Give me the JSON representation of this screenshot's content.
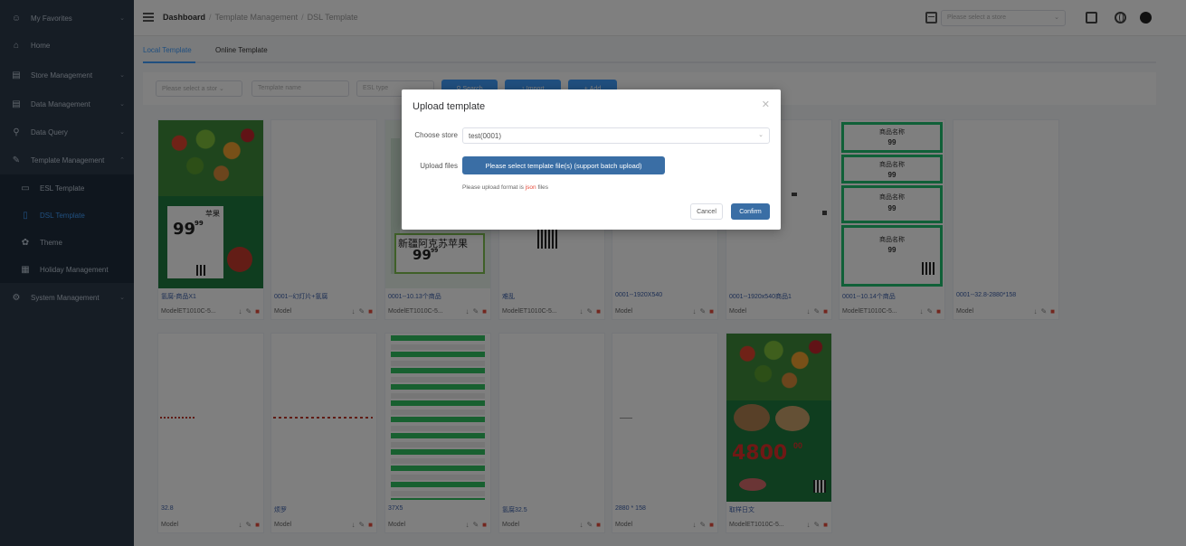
{
  "sidebar": {
    "items": [
      {
        "label": "My Favorites",
        "icon": "user-icon"
      },
      {
        "label": "Home",
        "icon": "home-icon"
      },
      {
        "label": "Store Management",
        "icon": "store-icon"
      },
      {
        "label": "Data Management",
        "icon": "database-icon"
      },
      {
        "label": "Data Query",
        "icon": "search-icon"
      },
      {
        "label": "Template Management",
        "icon": "template-icon"
      },
      {
        "label": "ESL Template",
        "icon": "monitor-icon"
      },
      {
        "label": "DSL Template",
        "icon": "tablet-icon"
      },
      {
        "label": "Theme",
        "icon": "palette-icon"
      },
      {
        "label": "Holiday Management",
        "icon": "calendar-icon"
      },
      {
        "label": "System Management",
        "icon": "gear-icon"
      }
    ]
  },
  "header": {
    "breadcrumb": [
      "Dashboard",
      "Template Management",
      "DSL Template"
    ],
    "store_placeholder": "Please select a store"
  },
  "tabs": [
    "Local Template",
    "Online Template"
  ],
  "filters": {
    "store_placeholder": "Please select a stor",
    "name_placeholder": "Template name",
    "type_placeholder": "ESL type",
    "search": "Search",
    "import": "Import",
    "add": "Add"
  },
  "cards": [
    {
      "title": "氢腐-商品X1",
      "model": "ModelET1010C-5..."
    },
    {
      "title": "0001--幻灯片+氢腐",
      "model": "Model"
    },
    {
      "title": "0001--10.13个商品",
      "model": "ModelET1010C-5..."
    },
    {
      "title": "难乱",
      "model": "ModelET1010C-5..."
    },
    {
      "title": "0001--1920X540",
      "model": "Model"
    },
    {
      "title": "0001--1920x540商品1",
      "model": "Model"
    },
    {
      "title": "0001--10.14个商品",
      "model": "ModelET1010C-5..."
    },
    {
      "title": "0001--32.8-2880*158",
      "model": "Model"
    },
    {
      "title": "32.8",
      "model": "Model"
    },
    {
      "title": "烦罗",
      "model": "Model"
    },
    {
      "title": "37X5",
      "model": "Model"
    },
    {
      "title": "氢腐32.5",
      "model": "Model"
    },
    {
      "title": "2880 * 158",
      "model": "Model"
    },
    {
      "title": "取样日文",
      "model": "ModelET1010C-5..."
    }
  ],
  "thumb_text": {
    "apple": "苹果",
    "price": "99",
    "price_sup": "99",
    "xinjiang": "新疆阿克苏苹果",
    "product_name": "商品名称",
    "big_price": "4800",
    "big_price_sup": "00"
  },
  "dialog": {
    "title": "Upload template",
    "store_label": "Choose store",
    "store_value": "test(0001)",
    "files_label": "Upload files",
    "upload_button": "Please select template file(s) (support batch upload)",
    "hint_prefix": "Please upload format is ",
    "hint_format": "json",
    "hint_suffix": " files",
    "cancel": "Cancel",
    "confirm": "Confirm"
  },
  "colors": {
    "sidebar_bg": "#2d3a4b",
    "primary": "#409eff",
    "dialog_button": "#3a6ea5",
    "delete": "#e74c3c",
    "green_frame": "#20c070"
  }
}
